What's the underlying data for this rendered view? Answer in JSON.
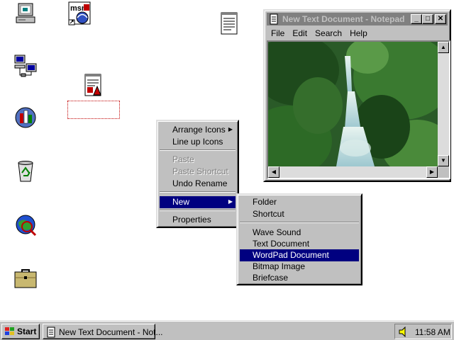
{
  "colors": {
    "desktop": "#ffffff",
    "face": "#c0c0c0",
    "highlight": "#000080",
    "inactive_title": "#808080"
  },
  "desktop_icons": [
    {
      "name": "my-computer-icon"
    },
    {
      "name": "msn-icon",
      "label": "msn"
    },
    {
      "name": "network-neighborhood-icon"
    },
    {
      "name": "wordpad-file-icon"
    },
    {
      "name": "online-services-icon"
    },
    {
      "name": "recycle-bin-icon"
    },
    {
      "name": "internet-explorer-icon"
    },
    {
      "name": "briefcase-icon"
    },
    {
      "name": "text-file-icon"
    }
  ],
  "notepad": {
    "title": "New Text Document - Notepad",
    "menu": [
      "File",
      "Edit",
      "Search",
      "Help"
    ],
    "content_image": "waterfall-forest-photo"
  },
  "context_menu": {
    "items": [
      {
        "label": "Arrange Icons",
        "submenu": true
      },
      {
        "label": "Line up Icons"
      },
      {
        "label": "Paste",
        "disabled": true
      },
      {
        "label": "Paste Shortcut",
        "disabled": true
      },
      {
        "label": "Undo Rename"
      },
      {
        "label": "New",
        "submenu": true,
        "selected": true
      },
      {
        "label": "Properties"
      }
    ]
  },
  "new_submenu": {
    "items": [
      {
        "label": "Folder"
      },
      {
        "label": "Shortcut"
      },
      {
        "label": "Wave Sound"
      },
      {
        "label": "Text Document"
      },
      {
        "label": "WordPad Document",
        "selected": true
      },
      {
        "label": "Bitmap Image"
      },
      {
        "label": "Briefcase"
      }
    ]
  },
  "taskbar": {
    "start_label": "Start",
    "task_label": "New Text Document - Not...",
    "clock": "11:58 AM",
    "tray_icon": "speaker-icon"
  }
}
